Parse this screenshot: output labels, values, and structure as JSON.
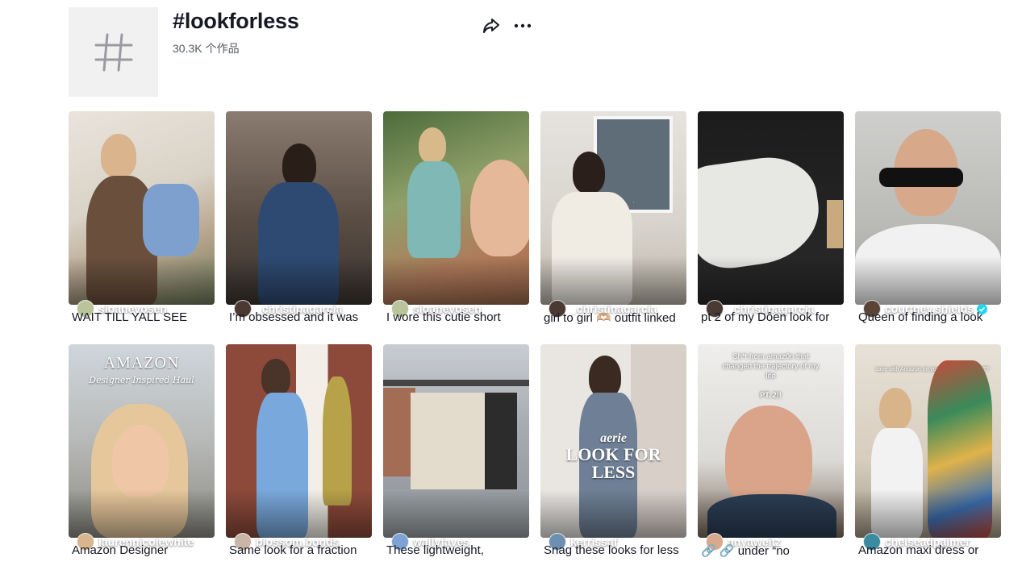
{
  "header": {
    "title": "#lookforless",
    "count": "30.3K",
    "count_unit": "个作品",
    "thumb_icon": "hashtag-icon",
    "share_icon": "share-icon",
    "more_icon": "more-icon"
  },
  "videos": [
    {
      "author": "sloanevosen",
      "caption": "WAIT TILL YALL SEE",
      "verified": false,
      "overlay": ""
    },
    {
      "author": "_christinagarcia",
      "caption": "I’m obsessed and it was",
      "verified": false,
      "overlay": ""
    },
    {
      "author": "sloanevosen",
      "caption": "I wore this cutie short",
      "verified": false,
      "overlay": ""
    },
    {
      "author": "_christinagarcia",
      "caption": "girl to girl 🫶🏼 outfit linked",
      "verified": false,
      "overlay": ""
    },
    {
      "author": "_christinagarcia",
      "caption": "pt 2 of my Dôen look for",
      "verified": false,
      "overlay": ""
    },
    {
      "author": "courtney.shields",
      "caption": "Queen of finding a look",
      "verified": true,
      "overlay": ""
    },
    {
      "author": "laurennicolewhite",
      "caption": "Amazon Designer",
      "verified": false,
      "overlay": "AMAZON",
      "overlay_sub": "Designer Inspired Haul"
    },
    {
      "author": "blossom.bonds",
      "caption": "Same look for a fraction",
      "verified": false,
      "overlay": ""
    },
    {
      "author": "wallyfaves",
      "caption": "These lightweight,",
      "verified": false,
      "overlay": ""
    },
    {
      "author": "kerrissaf",
      "caption": "Snag these looks for less",
      "verified": false,
      "overlay": "aerie",
      "overlay_sub": "LOOK FOR LESS"
    },
    {
      "author": "anyaweitz",
      "caption": "🔗 🔗 under “no",
      "verified": false,
      "overlay": "Sh*t from amaz0n that changed the trajectory of my life",
      "overlay_sub": "PT. 2!!"
    },
    {
      "author": "chelseadpalmer_",
      "caption": "Amazon maxi dress or",
      "verified": false,
      "overlay": "save with Amazon on your next Dress Pink??"
    }
  ]
}
